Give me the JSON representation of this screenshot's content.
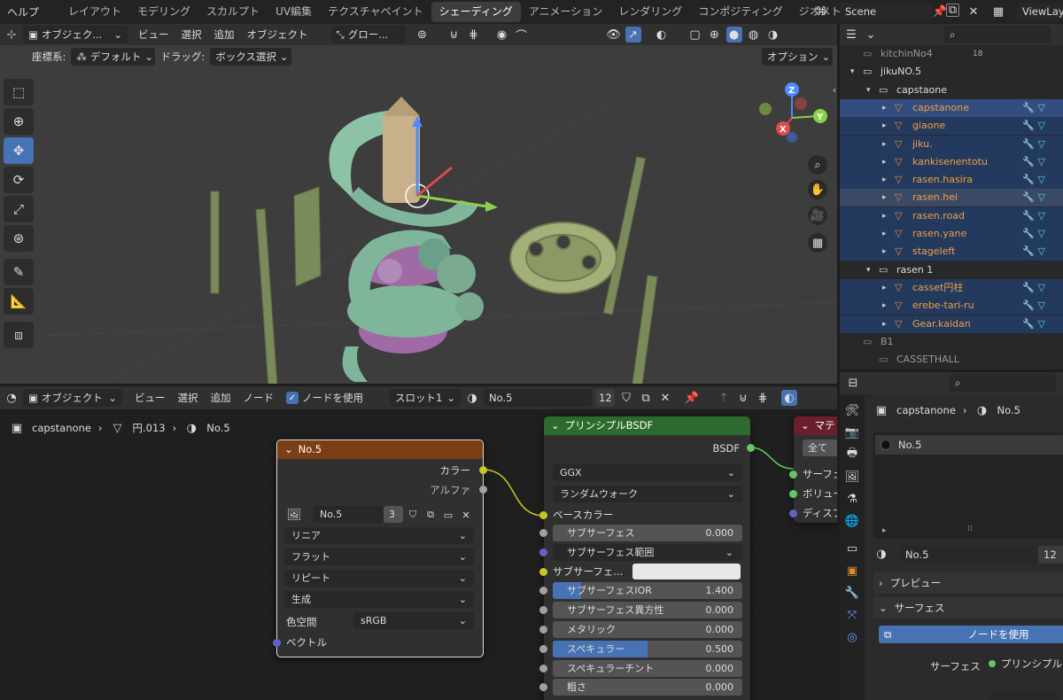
{
  "menubar": {
    "help": "ヘルプ",
    "tabs": [
      "レイアウト",
      "モデリング",
      "スカルプト",
      "UV編集",
      "テクスチャペイント",
      "シェーディング",
      "アニメーション",
      "レンダリング",
      "コンポジティング",
      "ジオメトリ"
    ],
    "active_tab": "シェーディング",
    "scene_label": "Scene",
    "viewlayer_label": "ViewLay"
  },
  "viewport_header": {
    "mode": "オブジェク...",
    "menus": [
      "ビュー",
      "選択",
      "追加",
      "オブジェクト"
    ],
    "transform_orient": "グロー...",
    "coord_label": "座標系:",
    "coord_value": "デフォルト",
    "drag_label": "ドラッグ:",
    "drag_value": "ボックス選択",
    "options": "オプション"
  },
  "node_header": {
    "mode": "オブジェクト",
    "menus": [
      "ビュー",
      "選択",
      "追加",
      "ノード"
    ],
    "use_nodes_label": "ノードを使用",
    "slot": "スロット1",
    "material_name": "No.5",
    "material_users": "12"
  },
  "breadcrumb": [
    "capstanone",
    "円.013",
    "No.5"
  ],
  "image_node": {
    "title": "No.5",
    "out_color": "カラー",
    "out_alpha": "アルファ",
    "image_name": "No.5",
    "image_users": "3",
    "interpolation": "リニア",
    "projection": "フラット",
    "extension": "リピート",
    "source": "生成",
    "colorspace_label": "色空間",
    "colorspace_value": "sRGB",
    "in_vector": "ベクトル"
  },
  "bsdf_node": {
    "title": "プリンシプルBSDF",
    "out_bsdf": "BSDF",
    "distribution": "GGX",
    "subsurface_method": "ランダムウォーク",
    "base_color": "ベースカラー",
    "rows": [
      {
        "label": "サブサーフェス",
        "value": "0.000",
        "fill": 0
      },
      {
        "label": "サブサーフェス範囲",
        "value": "",
        "dropdown": true
      },
      {
        "label": "サブサーフェ...",
        "value": "",
        "color": "#e8e8e8"
      },
      {
        "label": "サブサーフェスIOR",
        "value": "1.400",
        "fill": 0.15
      },
      {
        "label": "サブサーフェス異方性",
        "value": "0.000",
        "fill": 0
      },
      {
        "label": "メタリック",
        "value": "0.000",
        "fill": 0
      },
      {
        "label": "スペキュラー",
        "value": "0.500",
        "fill": 0.5
      },
      {
        "label": "スペキュラーチント",
        "value": "0.000",
        "fill": 0
      },
      {
        "label": "粗さ",
        "value": "0.000",
        "fill": 0
      }
    ]
  },
  "output_node": {
    "title": "マテ",
    "target": "全て",
    "inputs": [
      "サーフェ",
      "ボリュー",
      "ディスプ"
    ]
  },
  "outliner": {
    "rows": [
      {
        "indent": 1,
        "label": "kitchinNo4",
        "icon": "collection",
        "badge": "18",
        "dim": true
      },
      {
        "indent": 1,
        "label": "jikuNO.5",
        "icon": "collection",
        "expand": true
      },
      {
        "indent": 2,
        "label": "capstaone",
        "icon": "collection",
        "expand": true
      },
      {
        "indent": 3,
        "label": "capstanone",
        "icon": "mesh",
        "orange": true,
        "state": "act"
      },
      {
        "indent": 3,
        "label": "giaone",
        "icon": "mesh",
        "orange": true,
        "state": "sel"
      },
      {
        "indent": 3,
        "label": "jiku.",
        "icon": "mesh",
        "orange": true,
        "state": "sel"
      },
      {
        "indent": 3,
        "label": "kankisenentotu",
        "icon": "mesh",
        "orange": true,
        "state": "sel"
      },
      {
        "indent": 3,
        "label": "rasen.hasira",
        "icon": "mesh",
        "orange": true,
        "state": "sel"
      },
      {
        "indent": 3,
        "label": "rasen.hei",
        "icon": "mesh",
        "orange": true,
        "state": "hl"
      },
      {
        "indent": 3,
        "label": "rasen.road",
        "icon": "mesh",
        "orange": true,
        "state": "sel"
      },
      {
        "indent": 3,
        "label": "rasen.yane",
        "icon": "mesh",
        "orange": true,
        "state": "sel"
      },
      {
        "indent": 3,
        "label": "stageleft",
        "icon": "mesh",
        "orange": true,
        "state": "sel"
      },
      {
        "indent": 2,
        "label": "rasen 1",
        "icon": "collection",
        "expand": true
      },
      {
        "indent": 3,
        "label": "casset円柱",
        "icon": "mesh",
        "orange": true,
        "state": "sel"
      },
      {
        "indent": 3,
        "label": "erebe-tari-ru",
        "icon": "mesh",
        "orange": true,
        "state": "sel"
      },
      {
        "indent": 3,
        "label": "Gear.kaidan",
        "icon": "mesh",
        "orange": true,
        "state": "sel"
      },
      {
        "indent": 1,
        "label": "B1",
        "icon": "collection",
        "dim": true
      },
      {
        "indent": 2,
        "label": "CASSETHALL",
        "icon": "collection",
        "dim": true
      }
    ]
  },
  "properties": {
    "object_name": "capstanone",
    "material_name": "No.5",
    "slot_name": "No.5",
    "mat_selector": "No.5",
    "mat_users": "12",
    "preview_label": "プレビュー",
    "surface_panel": "サーフェス",
    "use_nodes_btn": "ノードを使用",
    "surface_label": "サーフェス",
    "surface_value": "プリンシプル"
  }
}
